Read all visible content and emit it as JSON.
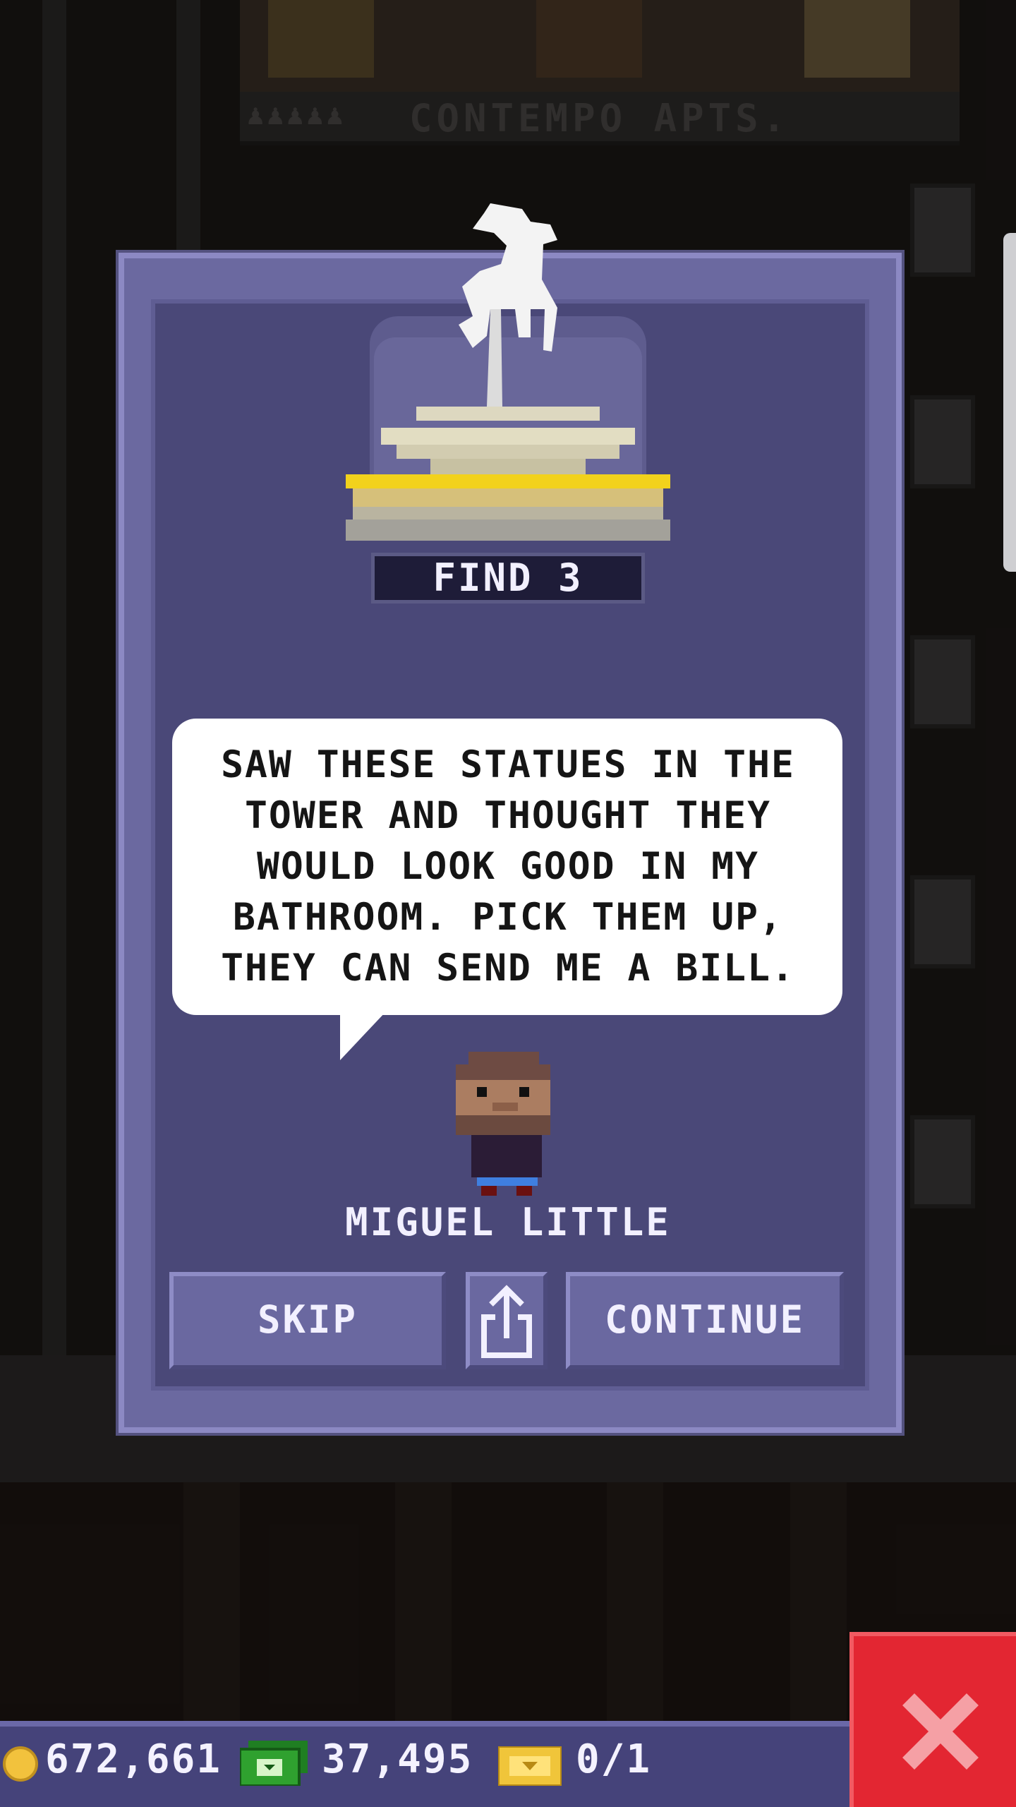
{
  "background": {
    "building_sign": "CONTEMPO APTS.",
    "sign_people": "♟♟♟♟♟"
  },
  "dialog": {
    "goal_label": "FIND 3",
    "message": "SAW THESE STATUES IN THE TOWER AND THOUGHT THEY WOULD LOOK GOOD IN MY BATHROOM. PICK THEM UP, THEY CAN SEND ME A BILL.",
    "speaker_name": "MIGUEL LITTLE",
    "buttons": {
      "skip": "SKIP",
      "continue": "CONTINUE"
    },
    "icons": {
      "trophy": "horse-statue-icon",
      "share": "share-icon",
      "character": "character-avatar"
    }
  },
  "status_bar": {
    "coins": "672,661",
    "bux": "37,495",
    "tickets": "0/1",
    "icons": {
      "coins": "coin-icon",
      "bux": "cash-icon",
      "tickets": "ticket-icon",
      "close": "close-icon"
    }
  },
  "colors": {
    "dialog_bg": "#4a4878",
    "dialog_border": "#8c89c3",
    "close_button": "#e32632",
    "coin": "#f2c23d",
    "cash": "#2fa12f",
    "ticket": "#f0c53a"
  }
}
